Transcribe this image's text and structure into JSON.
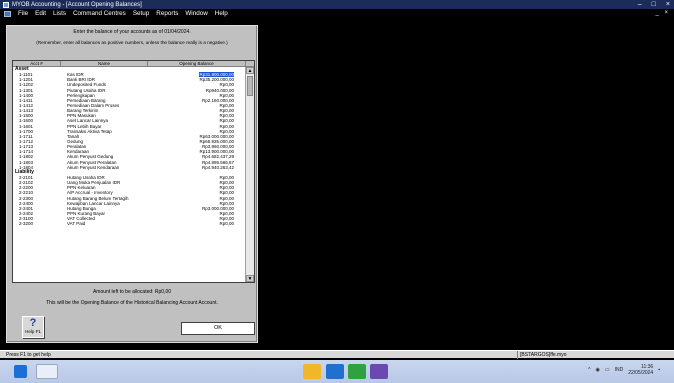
{
  "window": {
    "title": "MYOB Accounting - [Account Opening Balances]",
    "minimize": "–",
    "maximize": "□",
    "close": "×"
  },
  "menu": [
    "File",
    "Edit",
    "Lists",
    "Command Centres",
    "Setup",
    "Reports",
    "Window",
    "Help"
  ],
  "mdi_controls": "_ ×",
  "instructions": {
    "line1": "Enter the balance of your accounts as of 01/04/2024.",
    "line2": "(Remember, enter all balances as positive numbers, unless the balance really is a negative.)"
  },
  "grid": {
    "headers": [
      "Acct #",
      "Name",
      "Opening Balance"
    ],
    "sections": [
      {
        "title": "Asset",
        "rows": [
          [
            "1-1101",
            "Kas IDR",
            "Rp31.800.000,00",
            true
          ],
          [
            "1-1201",
            "Bank BRI IDR",
            "Rp35.200.000,00",
            false
          ],
          [
            "1-1202",
            "Undeposited Funds",
            "Rp0,00",
            false
          ],
          [
            "1-1301",
            "Piutang Usaha IDR",
            "Rp940.000,00",
            false
          ],
          [
            "1-1400",
            "Perlengkapan",
            "Rp0,00",
            false
          ],
          [
            "1-1411",
            "Persediaan Barang",
            "Rp2.160.000,00",
            false
          ],
          [
            "1-1412",
            "Persediaan Dalam Proses",
            "Rp0,00",
            false
          ],
          [
            "1-1413",
            "Barang Terkirim",
            "Rp0,00",
            false
          ],
          [
            "1-1500",
            "PPN Masukan",
            "Rp0,00",
            false
          ],
          [
            "1-1600",
            "Aset Lancar Lainnya",
            "Rp0,00",
            false
          ],
          [
            "1-1601",
            "PPN Lebih Bayar",
            "Rp0,00",
            false
          ],
          [
            "1-1700",
            "Transaksi Aktiva Tetap",
            "Rp0,00",
            false
          ],
          [
            "1-1711",
            "Tanah",
            "Rp63.000.000,00",
            false
          ],
          [
            "1-1712",
            "Gedung",
            "Rp65.935.000,00",
            false
          ],
          [
            "1-1713",
            "Peralatan",
            "Rp3.960.000,00",
            false
          ],
          [
            "1-1714",
            "Kendaraan",
            "Rp13.900.000,00",
            false
          ],
          [
            "1-1802",
            "Akum Penyust Gedung",
            "Rp4.682.437,29",
            false
          ],
          [
            "1-1803",
            "Akum Penyust Peralatan",
            "Rp4.895.566,67",
            false
          ],
          [
            "1-1804",
            "Akum Penyust Kendaraan",
            "Rp4.940.263,42",
            false
          ]
        ]
      },
      {
        "title": "Liability",
        "rows": [
          [
            "2-2101",
            "Hutang Usaha IDR",
            "Rp0,00",
            false
          ],
          [
            "2-2102",
            "Uang Muka Penjualan IDR",
            "Rp0,00",
            false
          ],
          [
            "2-2200",
            "PPN Keluaran",
            "Rp0,00",
            false
          ],
          [
            "2-2210",
            "A/P Accrual - Inventory",
            "Rp0,00",
            false
          ],
          [
            "2-2300",
            "Hutang Barang Belum Tertagih",
            "Rp0,00",
            false
          ],
          [
            "2-2400",
            "Kewajiban Lancar Lainnya",
            "Rp0,00",
            false
          ],
          [
            "2-2401",
            "Hutang Bunga",
            "Rp3.000.000,00",
            false
          ],
          [
            "2-2402",
            "PPN Kurang Bayar",
            "Rp0,00",
            false
          ],
          [
            "2-3100",
            "VAT Collected",
            "Rp0,00",
            false
          ],
          [
            "2-3200",
            "VAT Paid",
            "Rp0,00",
            false
          ]
        ]
      }
    ]
  },
  "allocation": "Amount left to be allocated: Rp0,00",
  "note": "This will be the Opening Balance of the Historical Balancing Account Account.",
  "help_button": {
    "glyph": "?",
    "label": "Help F1"
  },
  "ok_button": "OK",
  "status": {
    "left": "Press F1 to get help",
    "right": "[BSTARGOS]ffe.myo"
  },
  "tray": {
    "arrow": "^",
    "lang": "IND",
    "time": "11:36",
    "date": "22/05/2024"
  }
}
